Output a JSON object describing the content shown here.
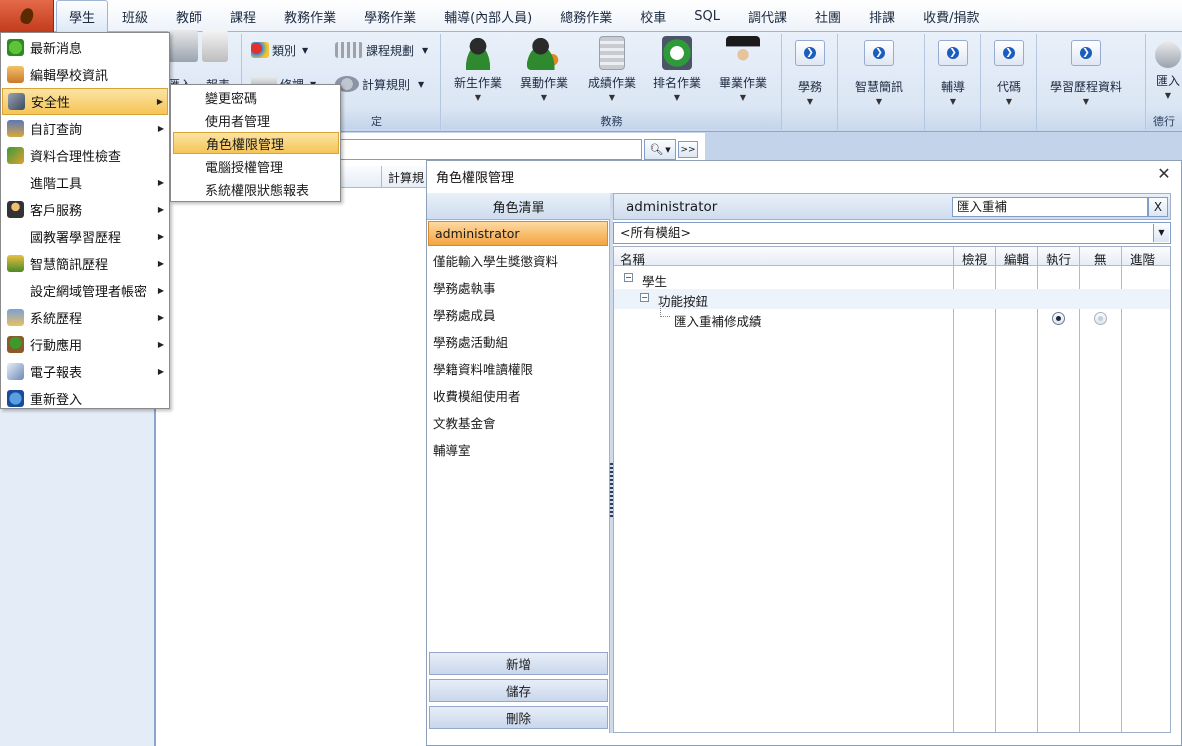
{
  "tabs": [
    "學生",
    "班級",
    "教師",
    "課程",
    "教務作業",
    "學務作業",
    "輔導(內部人員)",
    "總務作業",
    "校車",
    "SQL",
    "調代課",
    "社團",
    "排課",
    "收費/捐款"
  ],
  "ribbon": {
    "small_buttons": {
      "category": "類別",
      "course_planning": "課程規劃",
      "calc_rules": "計算規則"
    },
    "partial_labels": {
      "import": "匯入",
      "report": "報表",
      "edit": "修課",
      "settings_group": "定"
    },
    "academic_group": {
      "label": "教務",
      "buttons": [
        "新生作業",
        "異動作業",
        "成績作業",
        "排名作業",
        "畢業作業"
      ]
    },
    "nav_buttons": [
      "學務",
      "智慧簡訊",
      "輔導",
      "代碼",
      "學習歷程資料"
    ],
    "import_right": "匯入",
    "moral_group_label": "德行"
  },
  "main": {
    "grid_column": "計算規"
  },
  "start_menu": {
    "items": [
      {
        "label": "最新消息",
        "icon": "news-icon",
        "arrow": false
      },
      {
        "label": "編輯學校資訊",
        "icon": "school-info-icon",
        "arrow": false
      },
      {
        "label": "安全性",
        "icon": "security-icon",
        "arrow": true
      },
      {
        "label": "自訂查詢",
        "icon": "query-icon",
        "arrow": true
      },
      {
        "label": "資料合理性檢查",
        "icon": "check-icon",
        "arrow": false
      },
      {
        "label": "進階工具",
        "icon": "",
        "arrow": true
      },
      {
        "label": "客戶服務",
        "icon": "service-icon",
        "arrow": true
      },
      {
        "label": "國教署學習歷程",
        "icon": "",
        "arrow": true
      },
      {
        "label": "智慧簡訊歷程",
        "icon": "sms-icon",
        "arrow": true
      },
      {
        "label": "設定網域管理者帳密",
        "icon": "",
        "arrow": true
      },
      {
        "label": "系統歷程",
        "icon": "system-log-icon",
        "arrow": true
      },
      {
        "label": "行動應用",
        "icon": "mobile-icon",
        "arrow": true
      },
      {
        "label": "電子報表",
        "icon": "ereport-icon",
        "arrow": true
      },
      {
        "label": "重新登入",
        "icon": "relogin-icon",
        "arrow": false
      }
    ],
    "selected": "安全性"
  },
  "submenu": {
    "items": [
      "變更密碼",
      "使用者管理",
      "角色權限管理",
      "電腦授權管理",
      "系統權限狀態報表"
    ],
    "selected": "角色權限管理"
  },
  "dialog": {
    "title": "角色權限管理",
    "role_list_header": "角色清單",
    "roles": [
      "administrator",
      "僅能輸入學生獎懲資料",
      "學務處執事",
      "學務處成員",
      "學務處活動組",
      "學籍資料唯讀權限",
      "收費模組使用者",
      "文教基金會",
      "輔導室"
    ],
    "selected_role": "administrator",
    "buttons": {
      "add": "新增",
      "save": "儲存",
      "delete": "刪除"
    },
    "role_title": "administrator",
    "filter_value": "匯入重補",
    "filter_clear": "X",
    "module_select": "<所有模組>",
    "columns": {
      "name": "名稱",
      "view": "檢視",
      "edit": "編輯",
      "execute": "執行",
      "none": "無",
      "advanced": "進階"
    },
    "tree": {
      "root": "學生",
      "child": "功能按鈕",
      "leaf": "匯入重補修成績"
    },
    "leaf_permission": "執行"
  }
}
